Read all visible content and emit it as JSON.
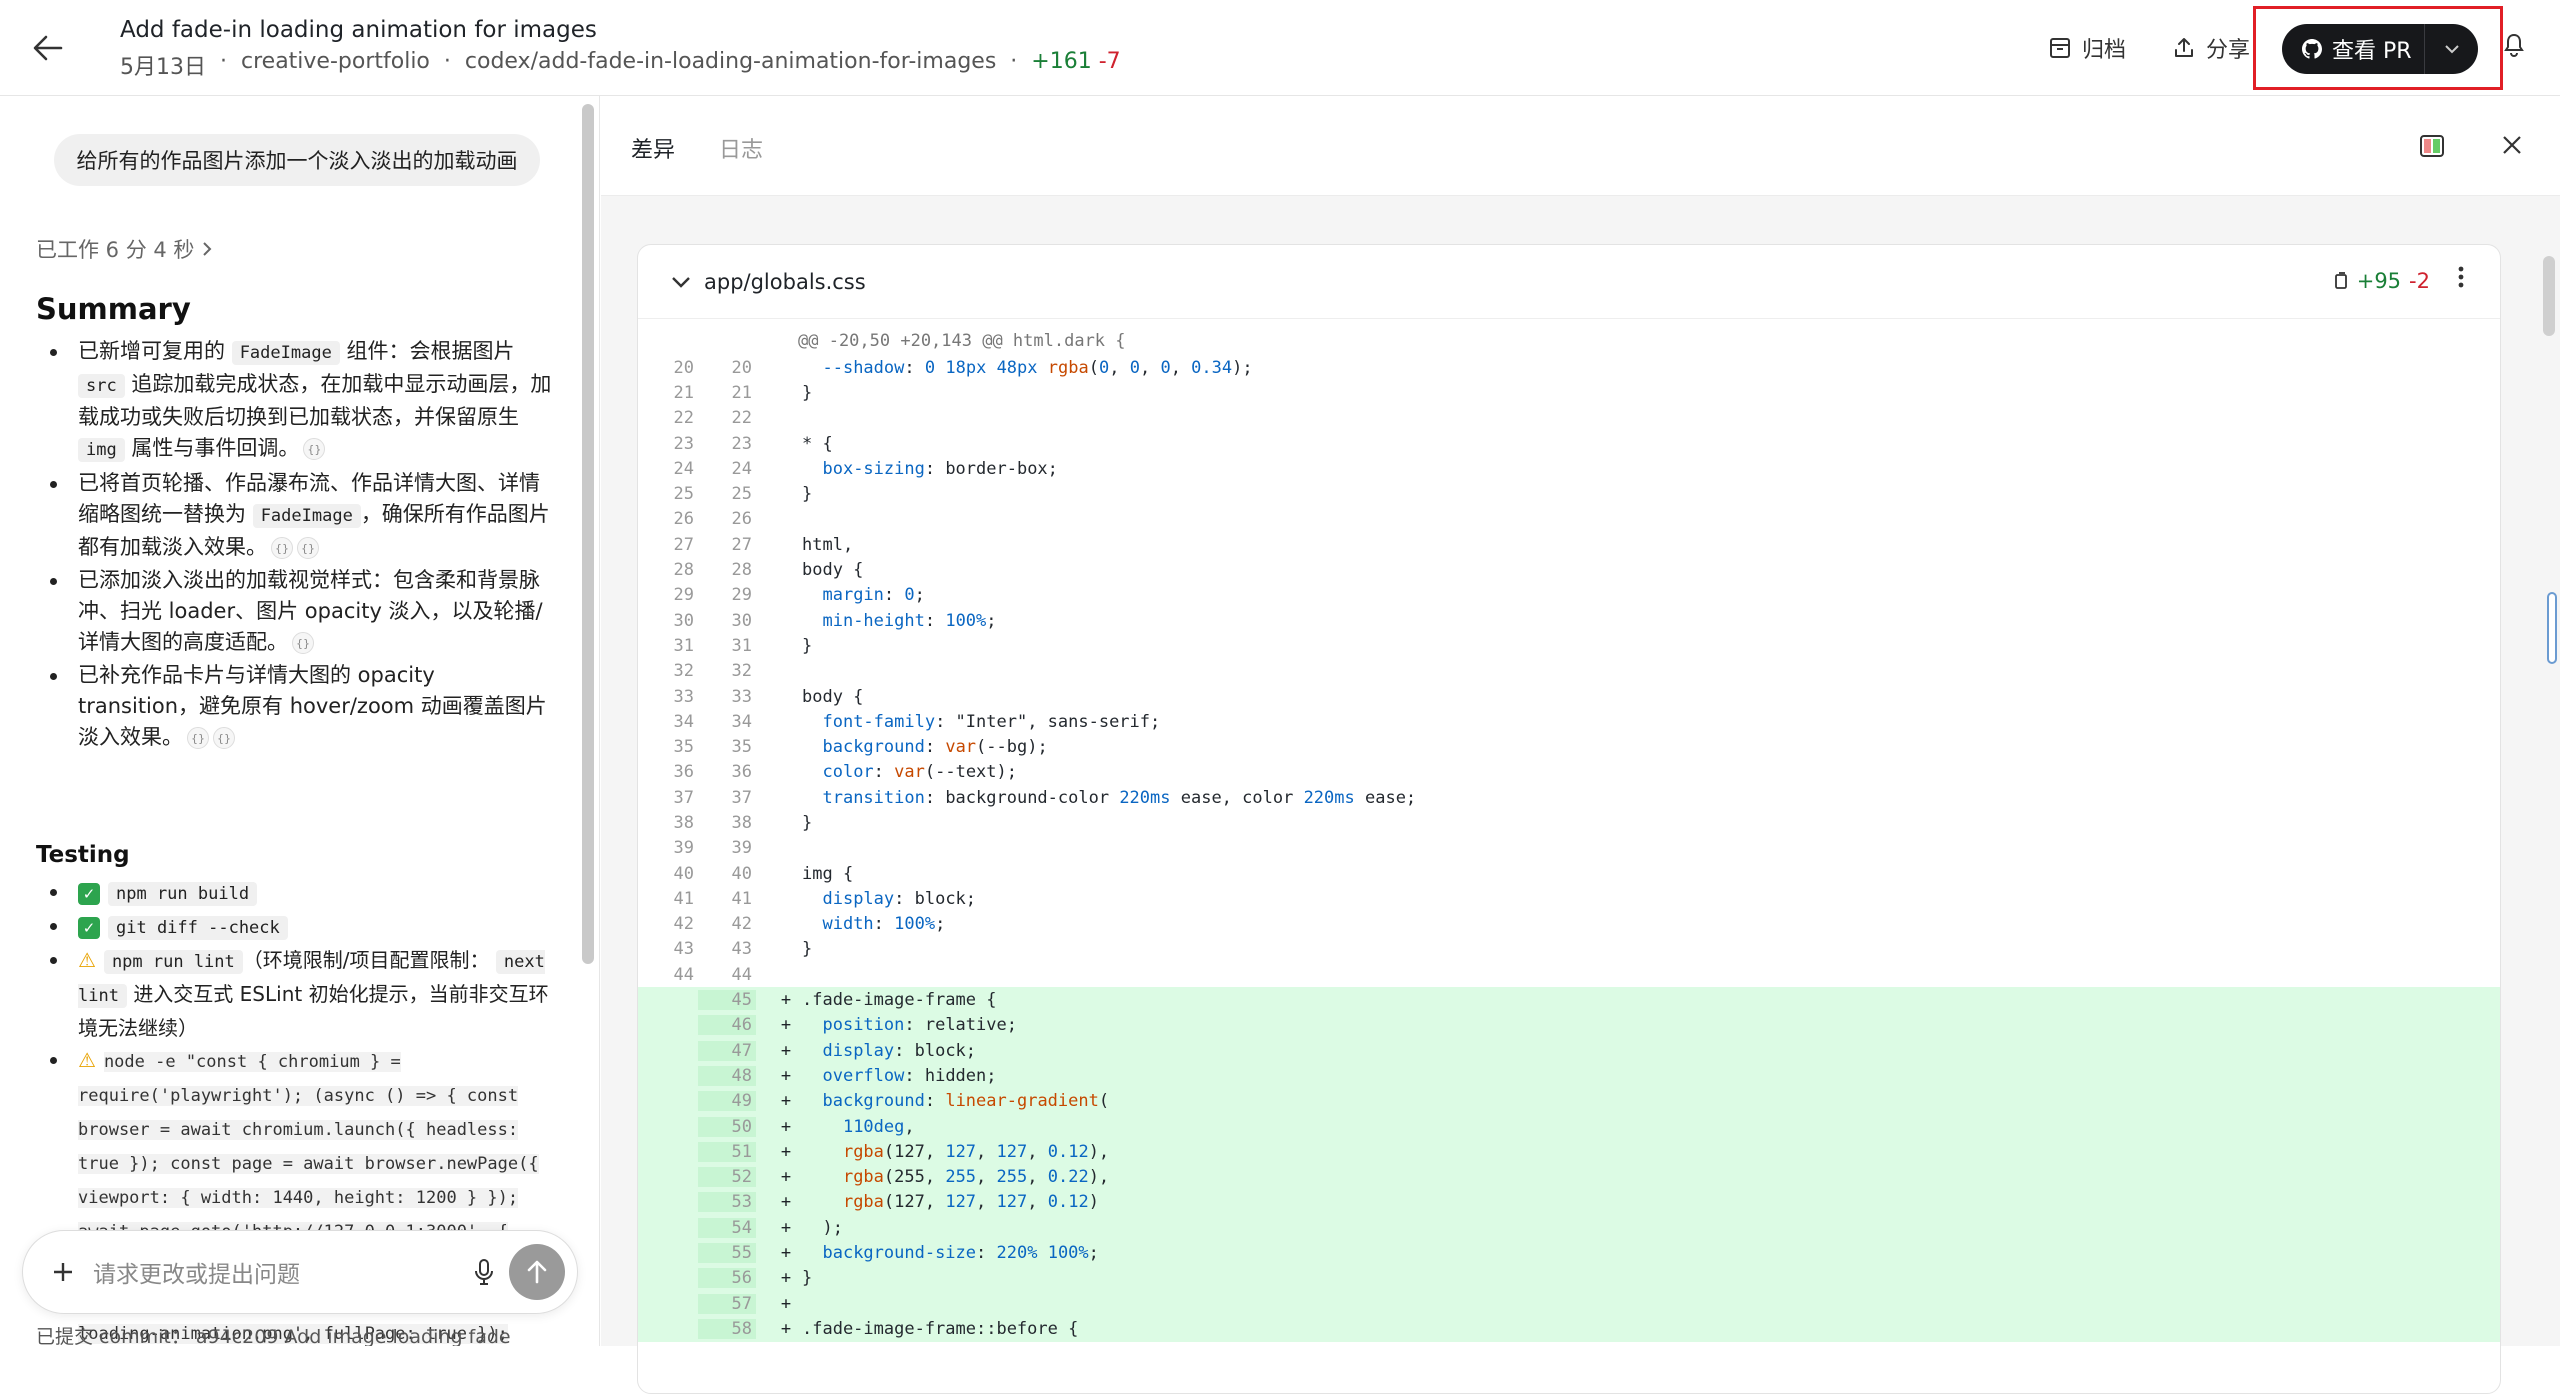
{
  "header": {
    "title": "Add fade-in loading animation for images",
    "date": "5月13日",
    "repo": "creative-portfolio",
    "branch": "codex/add-fade-in-loading-animation-for-images",
    "additions": "+161",
    "deletions": "-7",
    "archive_label": "归档",
    "share_label": "分享",
    "view_pr_label": "查看 PR"
  },
  "left": {
    "prompt": "给所有的作品图片添加一个淡入淡出的加载动画",
    "worked": "已工作 6 分 4 秒",
    "summary_title": "Summary",
    "summary": {
      "i1_a": "已新增可复用的",
      "i1_code1": "FadeImage",
      "i1_b": "组件：会根据图片",
      "i1_code2": "src",
      "i1_c": "追踪加载完成状态，在加载中显示动画层，加载成功或失败后切换到已加载状态，并保留原生",
      "i1_code3": "img",
      "i1_d": "属性与事件回调。",
      "i2_a": "已将首页轮播、作品瀑布流、作品详情大图、详情缩略图统一替换为",
      "i2_code": "FadeImage",
      "i2_b": "，确保所有作品图片都有加载淡入效果。",
      "i3": "已添加淡入淡出的加载视觉样式：包含柔和背景脉冲、扫光 loader、图片 opacity 淡入，以及轮播/详情大图的高度适配。",
      "i4": "已补充作品卡片与详情大图的 opacity transition，避免原有 hover/zoom 动画覆盖图片淡入效果。"
    },
    "testing_title": "Testing",
    "testing": {
      "t1": "npm run build",
      "t2": "git diff --check",
      "t3_code": "npm run lint",
      "t3_a": "（环境限制/项目配置限制：",
      "t3_code2": "next lint",
      "t3_b": "进入交互式 ESLint 初始化提示，当前非交互环境无法继续）",
      "t4_code": "node -e \"const { chromium } = require('playwright'); (async () => { const browser = await chromium.launch({ headless: true }); const page = await browser.newPage({ viewport: { width: 1440, height: 1200 } }); await page.goto('http://127.0.0.1:3000', { waitUntil: 'networkidle' }); await page.screenshot({ path: '/tmp/portfolio-loading-animation.png', fullPage: true });"
    },
    "composer_placeholder": "请求更改或提出问题",
    "bottom_text": "已提交 commit： a94c209 Add image loading fade"
  },
  "right": {
    "tab_diff": "差异",
    "tab_log": "日志",
    "file_name": "app/globals.css",
    "file_additions": "+95",
    "file_deletions": "-2",
    "hunk_header": "@@ -20,50 +20,143 @@ html.dark {"
  },
  "diff_lines": [
    {
      "o": "20",
      "n": "20",
      "t": "ctx",
      "c": "  --shadow: 0 18px 48px rgba(0, 0, 0, 0.34);"
    },
    {
      "o": "21",
      "n": "21",
      "t": "ctx",
      "c": "}"
    },
    {
      "o": "22",
      "n": "22",
      "t": "ctx",
      "c": ""
    },
    {
      "o": "23",
      "n": "23",
      "t": "ctx",
      "c": "* {"
    },
    {
      "o": "24",
      "n": "24",
      "t": "ctx",
      "c": "  box-sizing: border-box;"
    },
    {
      "o": "25",
      "n": "25",
      "t": "ctx",
      "c": "}"
    },
    {
      "o": "26",
      "n": "26",
      "t": "ctx",
      "c": ""
    },
    {
      "o": "27",
      "n": "27",
      "t": "ctx",
      "c": "html,"
    },
    {
      "o": "28",
      "n": "28",
      "t": "ctx",
      "c": "body {"
    },
    {
      "o": "29",
      "n": "29",
      "t": "ctx",
      "c": "  margin: 0;"
    },
    {
      "o": "30",
      "n": "30",
      "t": "ctx",
      "c": "  min-height: 100%;"
    },
    {
      "o": "31",
      "n": "31",
      "t": "ctx",
      "c": "}"
    },
    {
      "o": "32",
      "n": "32",
      "t": "ctx",
      "c": ""
    },
    {
      "o": "33",
      "n": "33",
      "t": "ctx",
      "c": "body {"
    },
    {
      "o": "34",
      "n": "34",
      "t": "ctx",
      "c": "  font-family: \"Inter\", sans-serif;"
    },
    {
      "o": "35",
      "n": "35",
      "t": "ctx",
      "c": "  background: var(--bg);"
    },
    {
      "o": "36",
      "n": "36",
      "t": "ctx",
      "c": "  color: var(--text);"
    },
    {
      "o": "37",
      "n": "37",
      "t": "ctx",
      "c": "  transition: background-color 220ms ease, color 220ms ease;"
    },
    {
      "o": "38",
      "n": "38",
      "t": "ctx",
      "c": "}"
    },
    {
      "o": "39",
      "n": "39",
      "t": "ctx",
      "c": ""
    },
    {
      "o": "40",
      "n": "40",
      "t": "ctx",
      "c": "img {"
    },
    {
      "o": "41",
      "n": "41",
      "t": "ctx",
      "c": "  display: block;"
    },
    {
      "o": "42",
      "n": "42",
      "t": "ctx",
      "c": "  width: 100%;"
    },
    {
      "o": "43",
      "n": "43",
      "t": "ctx",
      "c": "}"
    },
    {
      "o": "44",
      "n": "44",
      "t": "ctx",
      "c": ""
    },
    {
      "o": "",
      "n": "45",
      "t": "add",
      "c": ".fade-image-frame {"
    },
    {
      "o": "",
      "n": "46",
      "t": "add",
      "c": "  position: relative;"
    },
    {
      "o": "",
      "n": "47",
      "t": "add",
      "c": "  display: block;"
    },
    {
      "o": "",
      "n": "48",
      "t": "add",
      "c": "  overflow: hidden;"
    },
    {
      "o": "",
      "n": "49",
      "t": "add",
      "c": "  background: linear-gradient("
    },
    {
      "o": "",
      "n": "50",
      "t": "add",
      "c": "    110deg,"
    },
    {
      "o": "",
      "n": "51",
      "t": "add",
      "c": "    rgba(127, 127, 127, 0.12),"
    },
    {
      "o": "",
      "n": "52",
      "t": "add",
      "c": "    rgba(255, 255, 255, 0.22),"
    },
    {
      "o": "",
      "n": "53",
      "t": "add",
      "c": "    rgba(127, 127, 127, 0.12)"
    },
    {
      "o": "",
      "n": "54",
      "t": "add",
      "c": "  );"
    },
    {
      "o": "",
      "n": "55",
      "t": "add",
      "c": "  background-size: 220% 100%;"
    },
    {
      "o": "",
      "n": "56",
      "t": "add",
      "c": "}"
    },
    {
      "o": "",
      "n": "57",
      "t": "add",
      "c": ""
    },
    {
      "o": "",
      "n": "58",
      "t": "add",
      "c": ".fade-image-frame::before {"
    }
  ]
}
